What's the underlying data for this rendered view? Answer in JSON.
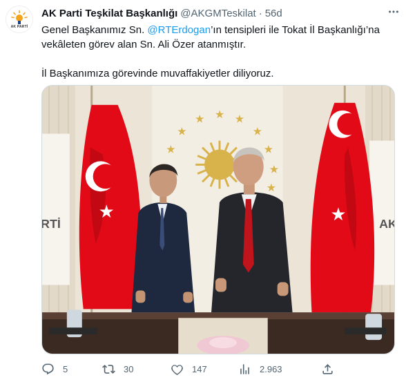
{
  "account": {
    "display_name": "AK Parti Teşkilat Başkanlığı",
    "handle": "@AKGMTeskilat",
    "separator": "·",
    "time": "56d",
    "avatar_label": "AK PARTİ"
  },
  "tweet": {
    "text_before_mention": "Genel Başkanımız Sn. ",
    "mention": "@RTErdogan",
    "text_after_mention": "’ın tensipleri ile Tokat İl Başkanlığı’na vekâleten görev alan Sn. Ali Özer atanmıştır.",
    "paragraph_2": "İl Başkanımıza görevinde muvaffakiyetler diliyoruz."
  },
  "media": {
    "flag_text_left": "RTİ",
    "flag_text_right": "AK"
  },
  "actions": {
    "reply_count": "5",
    "retweet_count": "30",
    "like_count": "147",
    "views_count": "2.963"
  },
  "colors": {
    "accent": "#1d9bf0",
    "secondary_text": "#536471",
    "flag_red": "#e30a17",
    "emblem_gold": "#d8b24a"
  },
  "icons": [
    "more-icon",
    "reply-icon",
    "retweet-icon",
    "like-icon",
    "views-icon",
    "share-icon"
  ]
}
